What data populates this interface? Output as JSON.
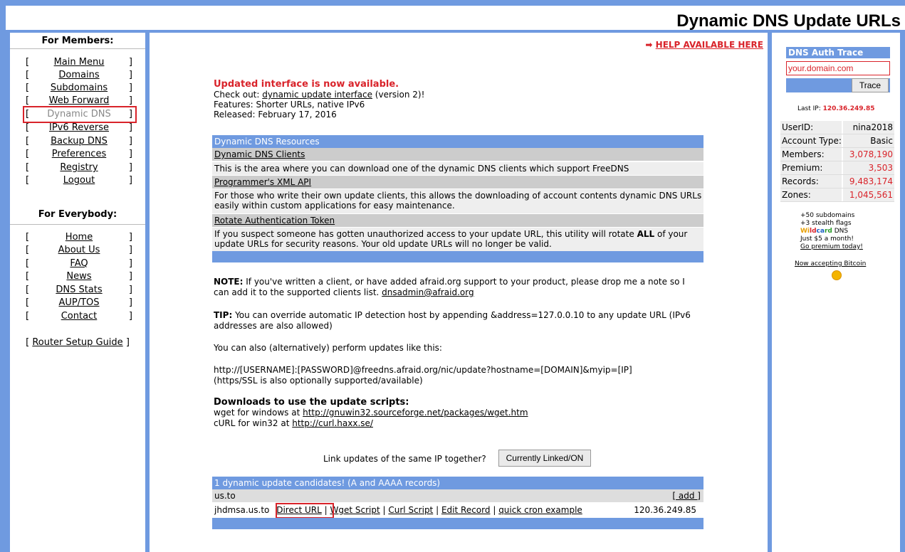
{
  "header": {
    "title": "Dynamic DNS Update URLs"
  },
  "sidebar": {
    "members_heading": "For Members:",
    "members_items": [
      {
        "label": "Main Menu"
      },
      {
        "label": "Domains"
      },
      {
        "label": "Subdomains"
      },
      {
        "label": "Web Forward"
      },
      {
        "label": "Dynamic DNS"
      },
      {
        "label": "IPv6 Reverse"
      },
      {
        "label": "Backup DNS"
      },
      {
        "label": "Preferences"
      },
      {
        "label": "Registry"
      },
      {
        "label": "Logout"
      }
    ],
    "everybody_heading": "For Everybody:",
    "everybody_items": [
      {
        "label": "Home"
      },
      {
        "label": "About Us"
      },
      {
        "label": "FAQ"
      },
      {
        "label": "News"
      },
      {
        "label": "DNS Stats"
      },
      {
        "label": "AUP/TOS"
      },
      {
        "label": "Contact"
      }
    ],
    "router_link": "Router Setup Guide",
    "bracket_open": "[",
    "bracket_close": "]"
  },
  "main": {
    "help_link": "HELP AVAILABLE HERE",
    "help_arrow": "➡",
    "update_title": "Updated interface is now available.",
    "checkout_prefix": "Check out: ",
    "checkout_link": "dynamic update interface",
    "checkout_suffix": " (version 2)!",
    "features": "Features: Shorter URLs, native IPv6",
    "released": "Released: February 17, 2016",
    "resources_heading": "Dynamic DNS Resources",
    "resources": [
      {
        "title": "Dynamic DNS Clients",
        "desc": "This is the area where you can download one of the dynamic DNS clients which support FreeDNS"
      },
      {
        "title": "Programmer's XML API",
        "desc": "For those who write their own update clients, this allows the downloading of account contents dynamic DNS URLs easily within custom applications for easy maintenance."
      },
      {
        "title": "Rotate Authentication Token",
        "desc_pre": "If you suspect someone has gotten unauthorized access to your update URL, this utility will rotate ",
        "desc_bold": "ALL",
        "desc_post": " of your update URLs for security reasons. Your old update URLs will no longer be valid."
      }
    ],
    "note_label": "NOTE:",
    "note_text": " If you've written a client, or have added afraid.org support to your product, please drop me a note so I can add it to the supported clients list. ",
    "note_email": "dnsadmin@afraid.org",
    "tip_label": "TIP:",
    "tip_text": " You can override automatic IP detection host by appending &address=127.0.0.10 to any update URL (IPv6 addresses are also allowed)",
    "alt_text": "You can also (alternatively) perform updates like this:",
    "alt_url": "http://[USERNAME]:[PASSWORD]@freedns.afraid.org/nic/update?hostname=[DOMAIN]&myip=[IP]",
    "alt_note": "(https/SSL is also optionally supported/available)",
    "downloads_heading": "Downloads to use the update scripts:",
    "wget_prefix": "wget for windows at ",
    "wget_link": "http://gnuwin32.sourceforge.net/packages/wget.htm",
    "curl_prefix": "cURL for win32 at ",
    "curl_link": "http://curl.haxx.se/",
    "link_question": "Link updates of the same IP together?",
    "link_button": "Currently Linked/ON",
    "candidates_heading": "1 dynamic update candidates! (A and AAAA records)",
    "domain_group": "us.to",
    "add_link": "[ add ]",
    "record": {
      "host": "jhdmsa.us.to",
      "actions": [
        "Direct URL",
        "Wget Script",
        "Curl Script",
        "Edit Record",
        "quick cron example"
      ],
      "separator": "|",
      "ip": "120.36.249.85"
    }
  },
  "right": {
    "trace_heading": "DNS Auth Trace",
    "trace_input_value": "your.domain.com",
    "trace_button": "Trace",
    "last_ip_label": "Last IP: ",
    "last_ip_value": "120.36.249.85",
    "stats": [
      {
        "key": "UserID:",
        "value": "nina2018",
        "red": false
      },
      {
        "key": "Account Type:",
        "value": "Basic",
        "red": false
      },
      {
        "key": "Members:",
        "value": "3,078,190",
        "red": true
      },
      {
        "key": "Premium:",
        "value": "3,503",
        "red": true
      },
      {
        "key": "Records:",
        "value": "9,483,174",
        "red": true
      },
      {
        "key": "Zones:",
        "value": "1,045,561",
        "red": true
      }
    ],
    "promo_line1": "+50 subdomains",
    "promo_line2": "+3 stealth flags",
    "promo_wild_a": "Wi",
    "promo_wild_b": "ld",
    "promo_wild_c": "ca",
    "promo_wild_d": "rd",
    "promo_dns": " DNS",
    "promo_line4": "Just $5 a month!",
    "promo_link": "Go premium today!",
    "bitcoin_link": "Now accepting Bitcoin"
  },
  "colors": {
    "accent": "#6f9ae0",
    "red": "#d9232a"
  }
}
